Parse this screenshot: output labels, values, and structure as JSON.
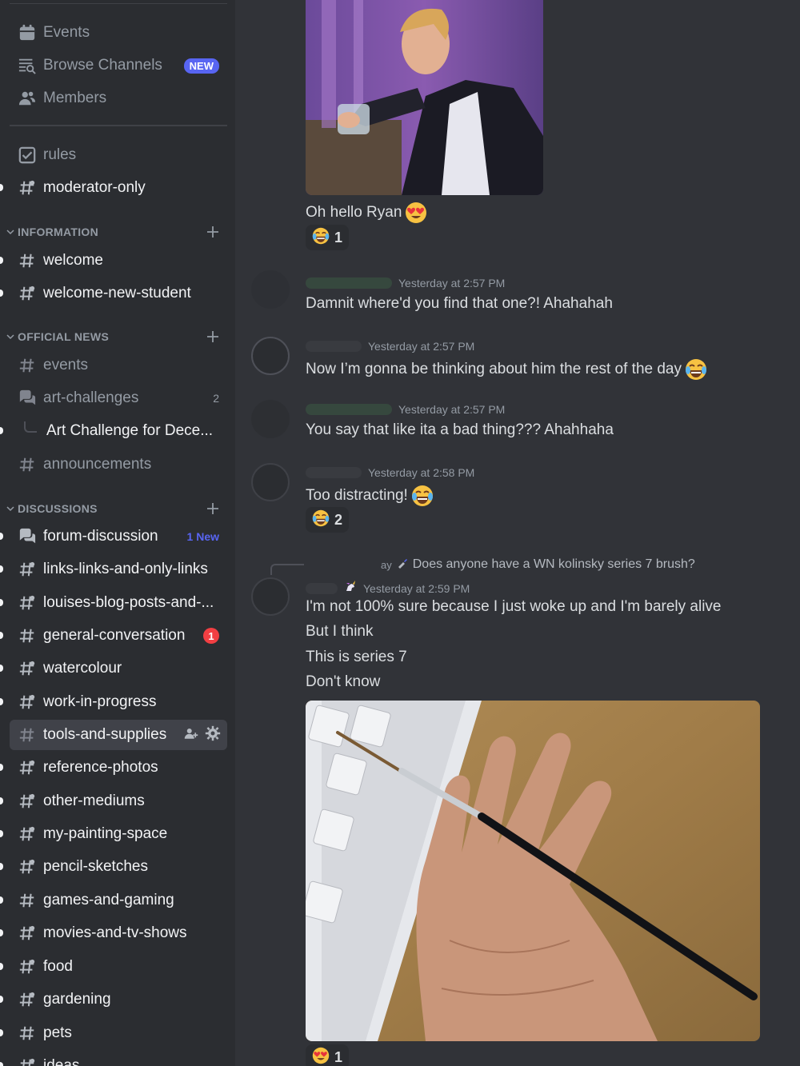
{
  "sidebar": {
    "top": [
      {
        "label": "Events",
        "icon": "calendar-icon"
      },
      {
        "label": "Browse Channels",
        "icon": "browse-channels-icon",
        "badge": "NEW"
      },
      {
        "label": "Members",
        "icon": "members-icon"
      }
    ],
    "pinned": [
      {
        "label": "rules",
        "icon": "rules-icon"
      },
      {
        "label": "moderator-only",
        "icon": "hashtag-thread-icon"
      }
    ],
    "categories": {
      "information": {
        "label": "INFORMATION",
        "channels": [
          "welcome",
          "welcome-new-student"
        ]
      },
      "official_news": {
        "label": "OFFICIAL NEWS",
        "channels": [
          "events",
          "art-challenges",
          "announcements"
        ],
        "art_challenges_count": "2",
        "thread": "Art Challenge for Dece..."
      },
      "discussions": {
        "label": "DISCUSSIONS",
        "forum": "forum-discussion",
        "forum_new": "1 New",
        "general_mentions": "1",
        "channels": [
          "links-links-and-only-links",
          "louises-blog-posts-and-...",
          "general-conversation",
          "watercolour",
          "work-in-progress",
          "tools-and-supplies",
          "reference-photos",
          "other-mediums",
          "my-painting-space",
          "pencil-sketches",
          "games-and-gaming",
          "movies-and-tv-shows",
          "food",
          "gardening",
          "pets",
          "ideas"
        ]
      }
    }
  },
  "chat": {
    "messages": [
      {
        "text": "Oh hello Ryan",
        "emoji": "heart-eyes-emoji",
        "reaction": {
          "emoji": "laugh-cry-emoji",
          "count": "1"
        }
      },
      {
        "timestamp": "Yesterday at 2:57 PM",
        "text": "Damnit where'd you find that one?! Ahahahah"
      },
      {
        "timestamp": "Yesterday at 2:57 PM",
        "text": "Now I’m gonna be thinking about him the rest of the day",
        "emoji": "laugh-cry-emoji"
      },
      {
        "timestamp": "Yesterday at 2:57 PM",
        "text": "You say that like ita a bad thing??? Ahahhaha"
      },
      {
        "timestamp": "Yesterday at 2:58 PM",
        "text": "Too distracting!",
        "emoji": "laugh-cry-emoji",
        "reaction": {
          "emoji": "laugh-cry-emoji",
          "count": "2"
        }
      },
      {
        "reply_prefix": "ay",
        "reply_to": "Does anyone have a WN kolinsky series 7 brush?",
        "timestamp": "Yesterday at 2:59 PM",
        "lines": [
          "I'm not 100% sure because I just woke up and I'm barely alive",
          "But I think",
          "This is series 7",
          "Don't know"
        ],
        "reaction": {
          "emoji": "heart-eyes-emoji",
          "count": "1"
        }
      }
    ]
  },
  "colors": {
    "sidebar_bg": "#2b2d31",
    "chat_bg": "#313338",
    "accent": "#5865f2",
    "mention_red": "#f23f43"
  }
}
